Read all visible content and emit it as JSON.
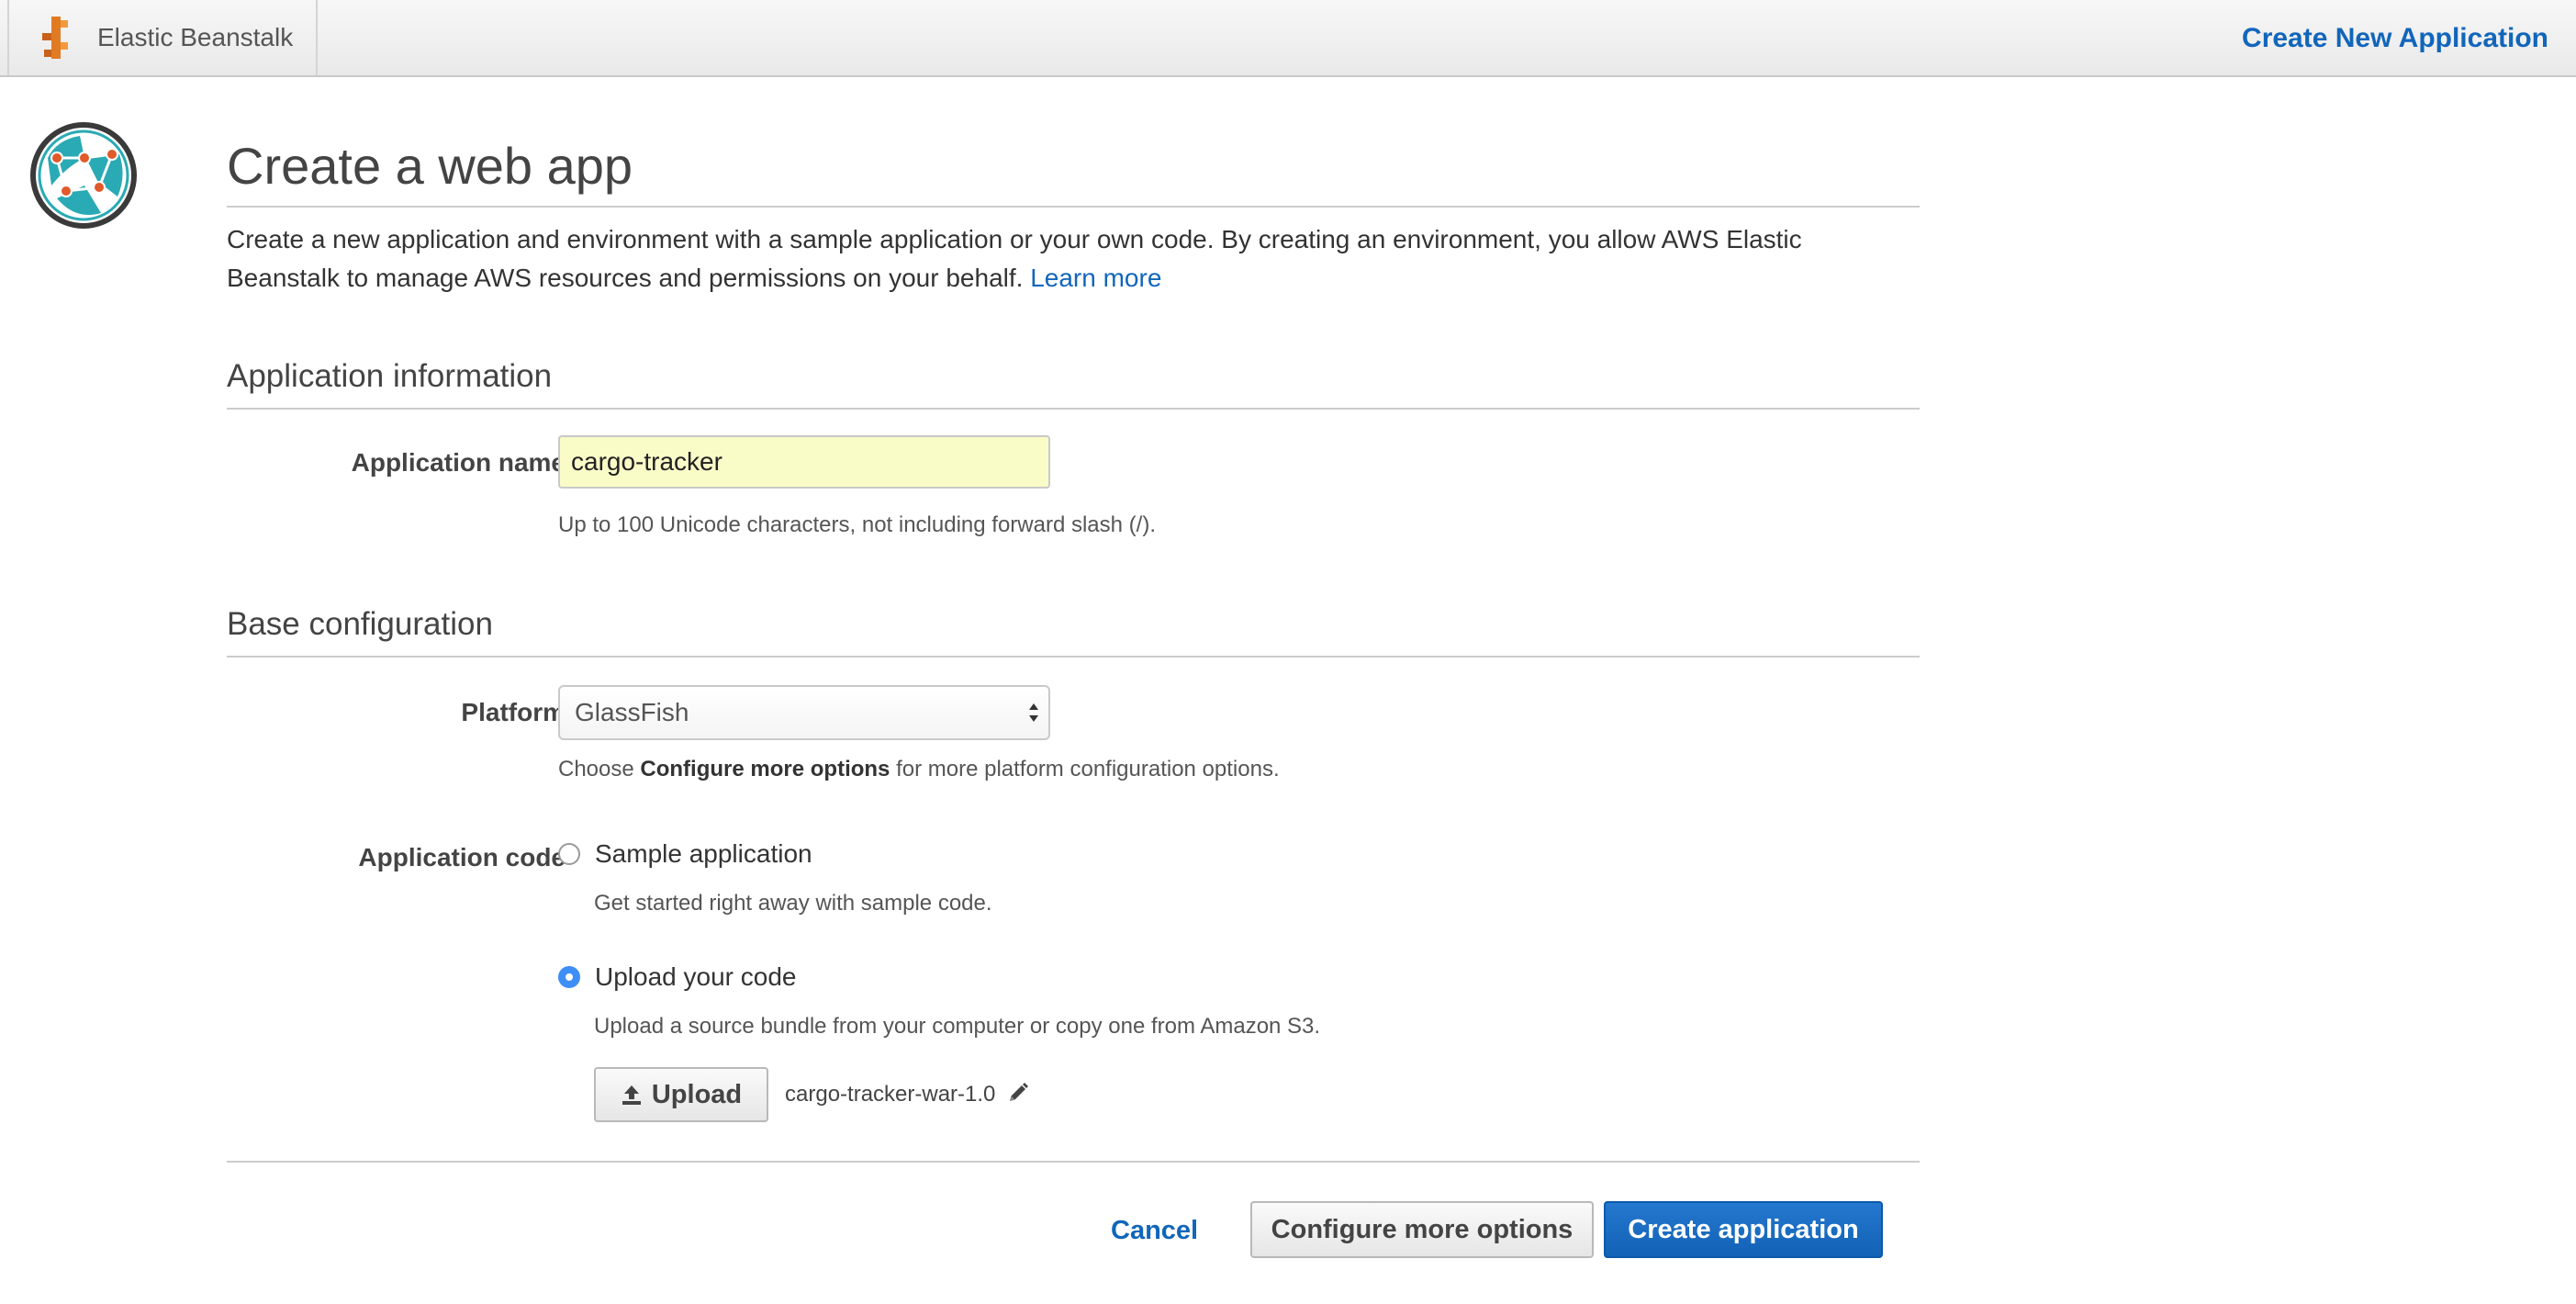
{
  "topbar": {
    "brand_name": "Elastic Beanstalk",
    "brand_icon": "elastic-beanstalk-logo",
    "right_link": "Create New Application"
  },
  "service_icon": "globe-network-icon",
  "page": {
    "title": "Create a web app",
    "intro_text": "Create a new application and environment with a sample application or your own code. By creating an environment, you allow AWS Elastic Beanstalk to manage AWS resources and permissions on your behalf.",
    "learn_more": "Learn more"
  },
  "app_info": {
    "section_title": "Application information",
    "name_label": "Application name",
    "name_value": "cargo-tracker",
    "name_help": "Up to 100 Unicode characters, not including forward slash (/)."
  },
  "base_config": {
    "section_title": "Base configuration",
    "platform_label": "Platform",
    "platform_value": "GlassFish",
    "platform_help_prefix": "Choose",
    "platform_help_bold": "Configure more options",
    "platform_help_suffix": "for more platform configuration options.",
    "code_label": "Application code",
    "options": [
      {
        "label": "Sample application",
        "description": "Get started right away with sample code.",
        "checked": false
      },
      {
        "label": "Upload your code",
        "description": "Upload a source bundle from your computer or copy one from Amazon S3.",
        "checked": true
      }
    ],
    "upload_label": "Upload",
    "file_name": "cargo-tracker-war-1.0"
  },
  "actions": {
    "cancel": "Cancel",
    "configure": "Configure more options",
    "create": "Create application"
  },
  "colors": {
    "link": "#1166bb",
    "primary": "#1a6ac3",
    "input_highlight": "#fafcc8",
    "radio_checked": "#3e8ef7"
  }
}
